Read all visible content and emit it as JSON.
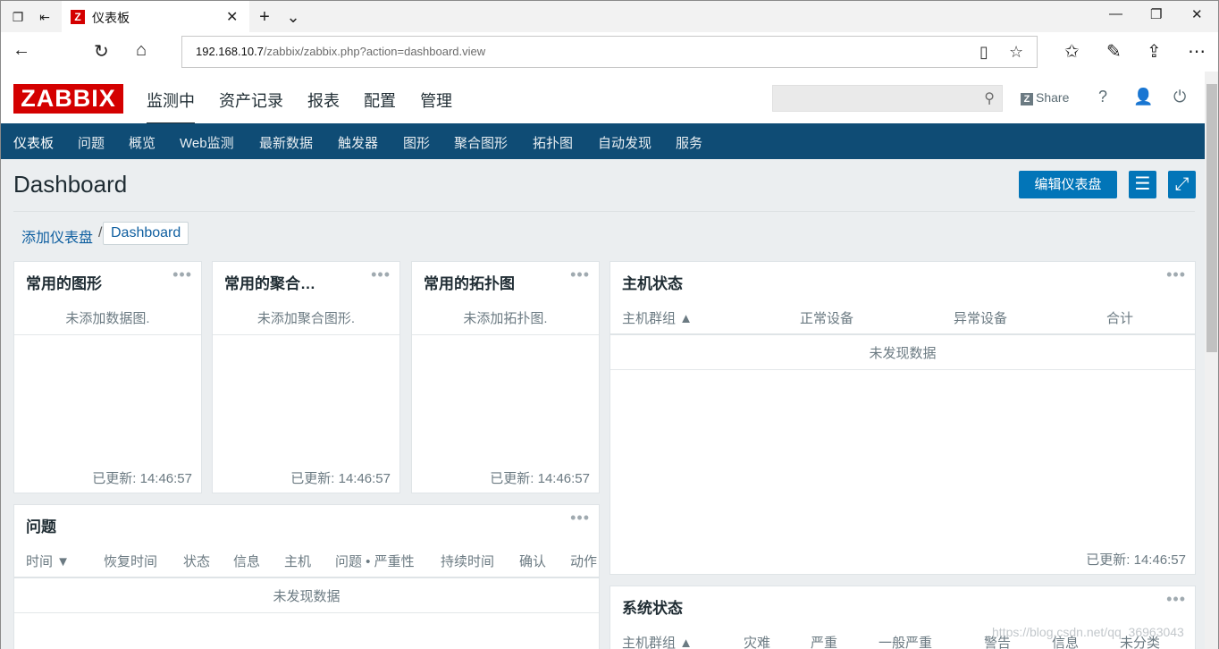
{
  "browser": {
    "tab_title": "仪表板",
    "tab_logo": "Z",
    "url_host": "192.168.10.7",
    "url_path": "/zabbix/zabbix.php?action=dashboard.view"
  },
  "zabbix": {
    "logo": "ZABBIX",
    "top_menu": [
      "监测中",
      "资产记录",
      "报表",
      "配置",
      "管理"
    ],
    "share_label": "Share",
    "share_logo": "Z",
    "help_label": "?",
    "sub_menu": [
      "仪表板",
      "问题",
      "概览",
      "Web监测",
      "最新数据",
      "触发器",
      "图形",
      "聚合图形",
      "拓扑图",
      "自动发现",
      "服务"
    ]
  },
  "page": {
    "title": "Dashboard",
    "edit_button": "编辑仪表盘",
    "breadcrumb_link": "添加仪表盘",
    "breadcrumb_sep": "/",
    "breadcrumb_current": "Dashboard"
  },
  "widgets": {
    "fav_graphs": {
      "title": "常用的图形",
      "message": "未添加数据图.",
      "updated": "已更新: 14:46:57"
    },
    "fav_screens": {
      "title": "常用的聚合…",
      "message": "未添加聚合图形.",
      "updated": "已更新: 14:46:57"
    },
    "fav_maps": {
      "title": "常用的拓扑图",
      "message": "未添加拓扑图.",
      "updated": "已更新: 14:46:57"
    },
    "host_status": {
      "title": "主机状态",
      "columns": [
        "主机群组 ▲",
        "正常设备",
        "异常设备",
        "合计"
      ],
      "message": "未发现数据",
      "updated": "已更新: 14:46:57"
    },
    "problems": {
      "title": "问题",
      "columns": [
        "时间 ▼",
        "恢复时间",
        "状态",
        "信息",
        "主机",
        "问题 • 严重性",
        "持续时间",
        "确认",
        "动作"
      ],
      "message": "未发现数据"
    },
    "system_status": {
      "title": "系统状态",
      "columns": [
        "主机群组 ▲",
        "灾难",
        "严重",
        "一般严重",
        "警告",
        "信息",
        "未分类"
      ]
    }
  },
  "dots": "•••",
  "watermark": "https://blog.csdn.net/qq_36963043",
  "icons": {
    "tab_set_aside": "❐",
    "tab_back": "⇤",
    "tab_close": "✕",
    "new_tab": "+",
    "tab_list": "⌄",
    "minimize": "—",
    "maximize": "❐",
    "close": "✕",
    "back": "←",
    "refresh": "↻",
    "home": "⌂",
    "reading_view": "▯",
    "favorite": "☆",
    "favorites_hub": "✩",
    "pen": "✎",
    "share": "⇪",
    "more": "⋯",
    "search": "⚲",
    "user": "👤",
    "power": "⏻",
    "menu": "☰",
    "fullscreen": "⤢"
  }
}
